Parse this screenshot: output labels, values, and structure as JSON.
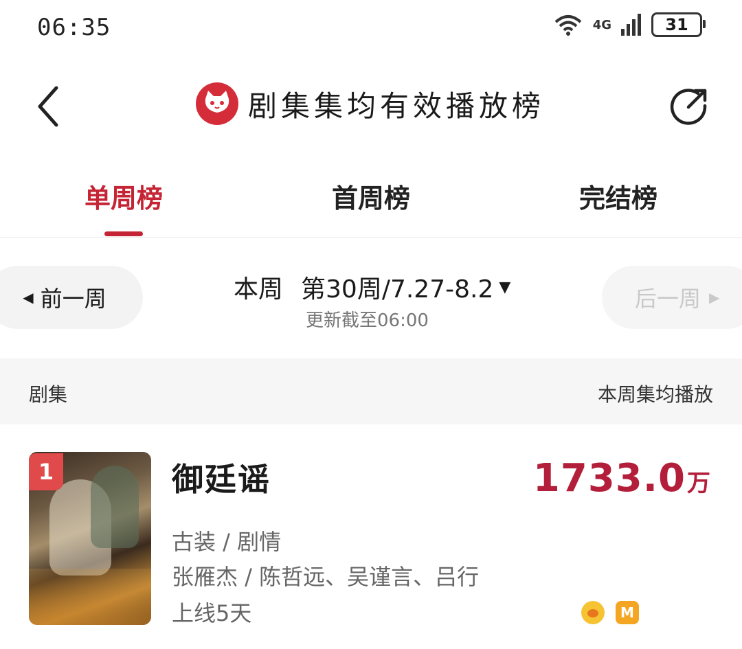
{
  "status_bar": {
    "time": "06:35",
    "network": "4G",
    "battery": "31"
  },
  "header": {
    "title": "剧集集均有效播放榜"
  },
  "tabs": [
    {
      "label": "单周榜",
      "active": true
    },
    {
      "label": "首周榜",
      "active": false
    },
    {
      "label": "完结榜",
      "active": false
    }
  ],
  "week_selector": {
    "prev_label": "前一周",
    "next_label": "后一周",
    "current_prefix": "本周",
    "current_range": "第30周/7.27-8.2",
    "updated": "更新截至06:00"
  },
  "list_header": {
    "left": "剧集",
    "right": "本周集均播放"
  },
  "items": [
    {
      "rank": "1",
      "title": "御廷谣",
      "genre": "古装 / 剧情",
      "cast": "张雁杰 / 陈哲远、吴谨言、吕行",
      "days": "上线5天",
      "plays_value": "1733.0",
      "plays_unit": "万"
    }
  ],
  "colors": {
    "accent": "#c42434",
    "plays": "#b31e3a",
    "logo": "#d42d39"
  },
  "icons": [
    "back-arrow-icon",
    "cat-logo-icon",
    "share-icon",
    "wifi-icon",
    "signal-icon",
    "battery-icon",
    "mango-tv-icon",
    "youku-icon"
  ]
}
